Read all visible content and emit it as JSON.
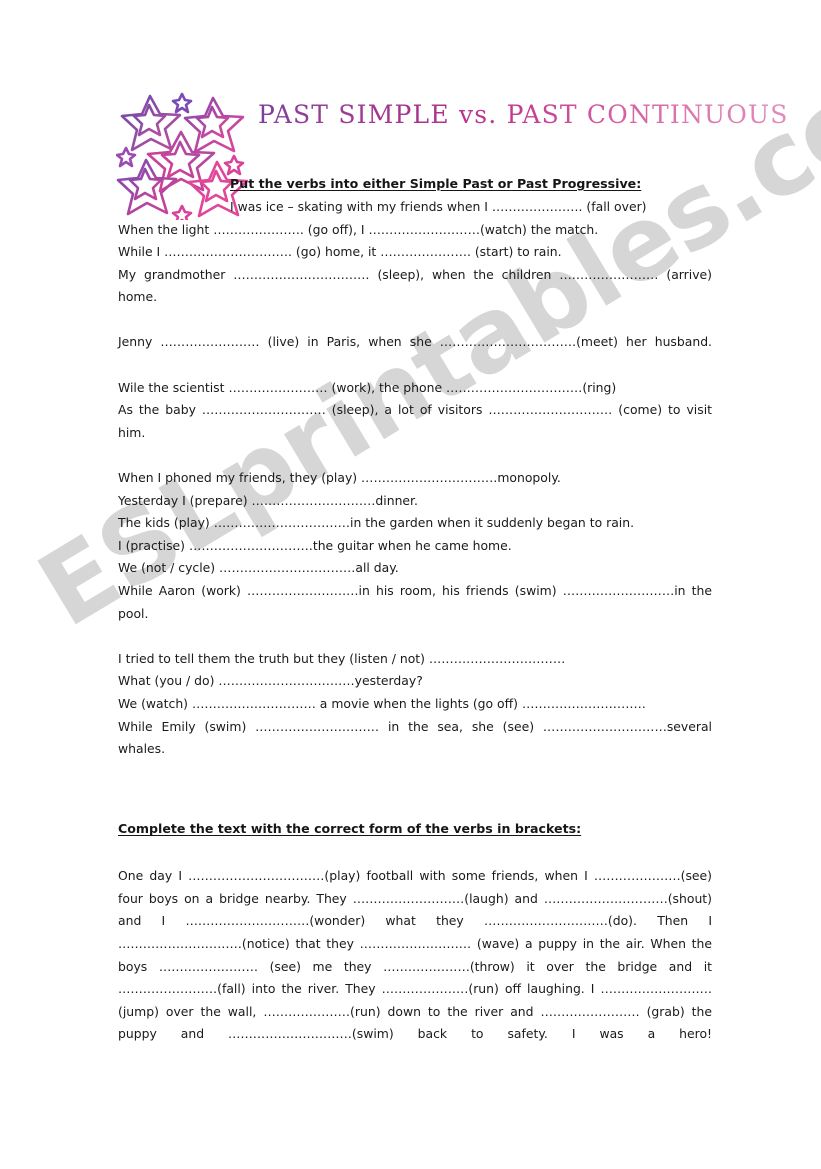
{
  "document": {
    "title": "PAST SIMPLE vs. PAST CONTINUOUS",
    "watermark": "ESLprintables.com",
    "title_color_start": "#7b3f9d",
    "title_color_end": "#e08cbc",
    "watermark_color": "#c9c9c9",
    "decoration": "stars-cluster-graphic"
  },
  "section1": {
    "heading": "Put the verbs into either Simple Past or Past Progressive:",
    "items": [
      "I was ice – skating with my friends when I …………………. (fall over)",
      "When the light …………………. (go off), I ………………………(watch) the match.",
      "While I …………………………. (go) home, it …………………. (start) to rain.",
      "My grandmother …………………………… (sleep), when the children …………………… (arrive) home.",
      "Jenny …………………… (live) in Paris, when  she ……………………………(meet) her husband.",
      "Wile the scientist …………………… (work), the phone ……………………………(ring)",
      "As the baby ………………………… (sleep), a lot of visitors ………………………… (come) to visit him.",
      "When I phoned my friends, they (play) ……………………………monopoly.",
      "Yesterday I (prepare) …………………………dinner.",
      "The kids (play) ……………………………in the garden when it suddenly began to rain.",
      "I (practise) …………………………the guitar when he came home.",
      "We (not / cycle) ……………………………all day.",
      "While Aaron (work) ………………………in his room, his friends (swim) ………………………in the pool.",
      "I tried to tell them the truth but they (listen / not) ……………………………",
      "What (you / do) ……………………………yesterday?",
      "We (watch) ………………………… a movie when the lights (go off) …………………………",
      "While Emily (swim) ………………………… in the sea, she (see) …………………………several whales."
    ]
  },
  "section2": {
    "heading": "Complete the text with the correct form of the verbs in brackets:",
    "text": "One day I ……………………………(play) football with some friends, when I …………………(see) four boys on a bridge nearby. They ………………………(laugh) and …………………………(shout) and I  …………………………(wonder) what they …………………………(do). Then I  …………………………(notice) that they ……………………… (wave) a puppy in the air. When the boys …………………… (see) me they …………………(throw) it over the bridge and it  ……………………(fall) into the river. They …………………(run) off laughing. I ………………………(jump) over the wall, …………………(run) down to the river and  …………………… (grab) the puppy and …………………………(swim) back to safety. I was a hero!"
  }
}
